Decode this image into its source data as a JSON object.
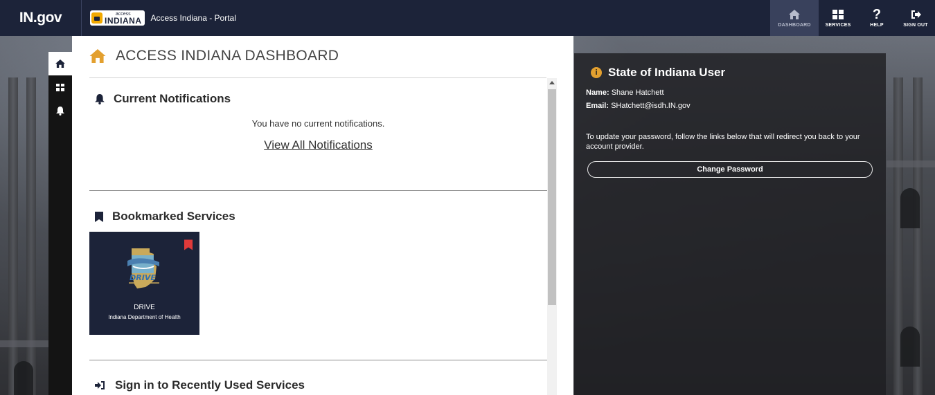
{
  "brand": {
    "ingov_logo": "IN.gov",
    "access_indiana_small": "access",
    "access_indiana_big": "INDIANA",
    "portal_title": "Access Indiana - Portal"
  },
  "topnav": {
    "items": [
      {
        "label": "DASHBOARD",
        "icon": "home-icon",
        "active": true
      },
      {
        "label": "SERVICES",
        "icon": "grid-icon",
        "active": false
      },
      {
        "label": "HELP",
        "icon": "question-icon",
        "active": false
      },
      {
        "label": "SIGN OUT",
        "icon": "sign-out-icon",
        "active": false
      }
    ]
  },
  "rail": {
    "items": [
      {
        "icon": "home-icon",
        "active": true
      },
      {
        "icon": "grid-icon",
        "active": false
      },
      {
        "icon": "bell-icon",
        "active": false
      }
    ]
  },
  "dashboard": {
    "title": "ACCESS INDIANA DASHBOARD",
    "notifications": {
      "heading": "Current Notifications",
      "message": "You have no current notifications.",
      "link": "View All Notifications"
    },
    "bookmarks": {
      "heading": "Bookmarked Services",
      "items": [
        {
          "name": "DRIVE",
          "department": "Indiana Department of Health",
          "logo_text": "DRIVE",
          "bookmarked": true
        }
      ]
    },
    "recent": {
      "heading": "Sign in to Recently Used Services"
    }
  },
  "user_panel": {
    "title": "State of Indiana User",
    "name_label": "Name:",
    "name": "Shane Hatchett",
    "email_label": "Email:",
    "email": "SHatchett@isdh.IN.gov",
    "message": "To update your password, follow the links below that will redirect you back to your account provider.",
    "button": "Change Password"
  },
  "colors": {
    "navbar": "#1c2339",
    "accent": "#e3a02f",
    "bookmark_red": "#e03a3a",
    "tile_bg": "#1c2339"
  }
}
